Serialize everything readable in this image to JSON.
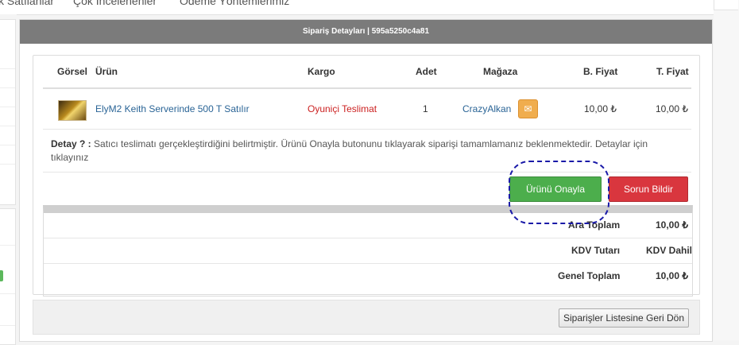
{
  "nav": {
    "items": [
      "k Satılanlar",
      "Çok İncelenenler",
      "Ödeme Yöntemlerimiz"
    ]
  },
  "panel": {
    "title": "Sipariş Detayları | 595a5250c4a81"
  },
  "table": {
    "headers": {
      "image": "Görsel",
      "product": "Ürün",
      "shipping": "Kargo",
      "qty": "Adet",
      "store": "Mağaza",
      "unit_price": "B. Fiyat",
      "total_price": "T. Fiyat"
    },
    "row": {
      "product": "ElyM2 Keith Serverinde 500 T Satılır",
      "shipping": "Oyuniçi Teslimat",
      "qty": "1",
      "store": "CrazyAlkan",
      "unit_price": "10,00 ₺",
      "total_price": "10,00 ₺"
    }
  },
  "detail": {
    "label": "Detay ? :",
    "text": "Satıcı teslimatı gerçekleştirdiğini belirtmiştir. Ürünü Onayla butonunu tıklayarak siparişi tamamlamanız beklenmektedir. Detaylar için tıklayınız"
  },
  "actions": {
    "confirm": "Ürünü Onayla",
    "report": "Sorun Bildir"
  },
  "totals": [
    {
      "label": "Ara Toplam",
      "value": "10,00 ₺"
    },
    {
      "label": "KDV Tutarı",
      "value": "KDV Dahil"
    },
    {
      "label": "Genel Toplam",
      "value": "10,00 ₺"
    }
  ],
  "footer": {
    "back": "Siparişler Listesine Geri Dön"
  },
  "icons": {
    "mail": "envelope-icon",
    "product_image": "product-thumbnail"
  },
  "colors": {
    "header": "#7b7b7b",
    "confirm": "#4cae4c",
    "report": "#d9363e",
    "mail": "#f0ad4e",
    "highlight": "#1a1aa8"
  }
}
